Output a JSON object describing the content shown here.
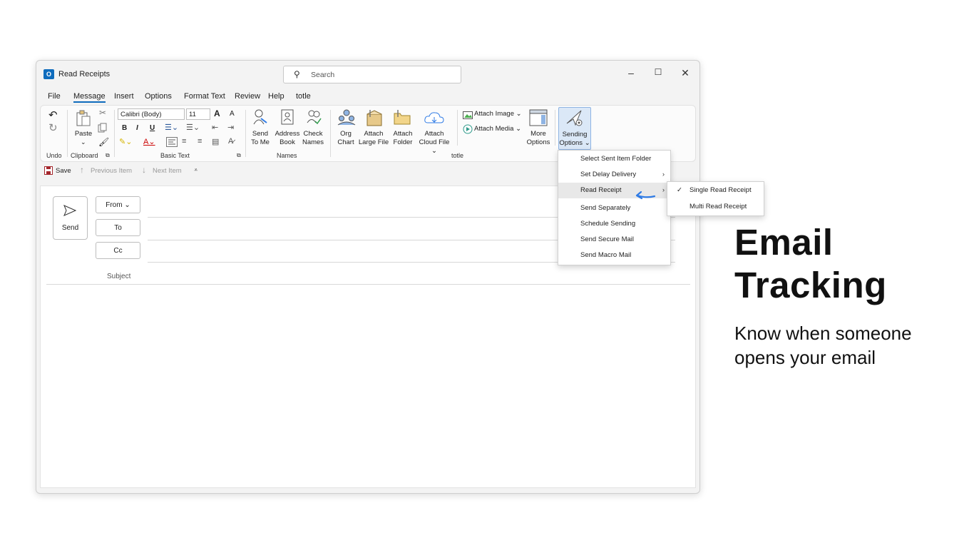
{
  "window": {
    "title": "Read Receipts",
    "search_placeholder": "Search"
  },
  "window_controls": {
    "minimize": "–",
    "maximize": "☐",
    "close": "✕"
  },
  "menu": [
    "File",
    "Message",
    "Insert",
    "Options",
    "Format Text",
    "Review",
    "Help",
    "totle"
  ],
  "ribbon": {
    "undo_group": "Undo",
    "clipboard": {
      "paste": "Paste",
      "group": "Clipboard"
    },
    "basic_text": {
      "font_name": "Calibri (Body)",
      "font_size": "11",
      "bold": "B",
      "italic": "I",
      "underline": "U",
      "grow": "A",
      "shrink": "A",
      "group": "Basic Text"
    },
    "names": {
      "send_to_me_1": "Send",
      "send_to_me_2": "To Me",
      "address_book_1": "Address",
      "address_book_2": "Book",
      "check_names_1": "Check",
      "check_names_2": "Names",
      "group": "Names"
    },
    "totle": {
      "org_chart_1": "Org",
      "org_chart_2": "Chart",
      "attach_large_1": "Attach",
      "attach_large_2": "Large File",
      "attach_folder_1": "Attach",
      "attach_folder_2": "Folder",
      "attach_cloud_1": "Attach",
      "attach_cloud_2": "Cloud File",
      "attach_image": "Attach Image",
      "attach_media": "Attach Media",
      "more_options_1": "More",
      "more_options_2": "Options",
      "sending_options_1": "Sending",
      "sending_options_2": "Options",
      "group": "totle"
    }
  },
  "quick_access": {
    "save": "Save",
    "previous": "Previous Item",
    "next": "Next Item"
  },
  "compose": {
    "send": "Send",
    "from": "From",
    "to": "To",
    "cc": "Cc",
    "subject": "Subject"
  },
  "dropdown": {
    "items": [
      "Select Sent Item Folder",
      "Set Delay Delivery",
      "Read Receipt",
      "Send Separately",
      "Schedule Sending",
      "Send Secure Mail",
      "Send Macro Mail"
    ]
  },
  "submenu": {
    "items": [
      "Single Read Receipt",
      "Multi Read Receipt"
    ],
    "checked": "Single Read Receipt"
  },
  "promo": {
    "title_line1": "Email",
    "title_line2": "Tracking",
    "subtitle_line1": "Know when someone",
    "subtitle_line2": "opens your email"
  },
  "colors": {
    "accent": "#0f6cbd",
    "arrow": "#2f7be5"
  }
}
